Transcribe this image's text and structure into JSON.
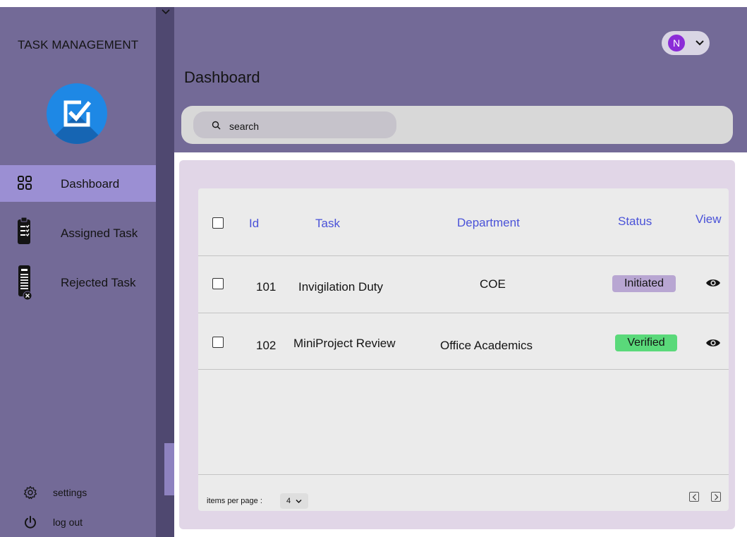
{
  "app": {
    "title": "TASK MANAGEMENT"
  },
  "sidebar": {
    "items": [
      {
        "label": "Dashboard",
        "icon": "grid-icon",
        "active": true
      },
      {
        "label": "Assigned Task",
        "icon": "clipboard-check-icon",
        "active": false
      },
      {
        "label": "Rejected Task",
        "icon": "clipboard-rejected-icon",
        "active": false
      }
    ],
    "bottom": [
      {
        "label": "settings",
        "icon": "gear-icon"
      },
      {
        "label": "log out",
        "icon": "power-icon"
      }
    ]
  },
  "header": {
    "title": "Dashboard",
    "user": {
      "initial": "N"
    }
  },
  "search": {
    "placeholder": "search",
    "value": ""
  },
  "table": {
    "columns": [
      "Id",
      "Task",
      "Department",
      "Status",
      "View"
    ],
    "rows": [
      {
        "id": "101",
        "task": "Invigilation Duty",
        "department": "COE",
        "status": "Initiated"
      },
      {
        "id": "102",
        "task": "MiniProject Review",
        "department": "Office Academics",
        "status": "Verified"
      }
    ]
  },
  "footer": {
    "items_per_page_label": "items per page :",
    "items_per_page_value": "4"
  },
  "colors": {
    "sidebar": "#736a97",
    "active_item": "#9b8fd3",
    "header_text": "#4a52d8",
    "initiated_badge": "#b8a6d2",
    "verified_badge": "#5ad97a",
    "avatar": "#8b2cd7"
  }
}
